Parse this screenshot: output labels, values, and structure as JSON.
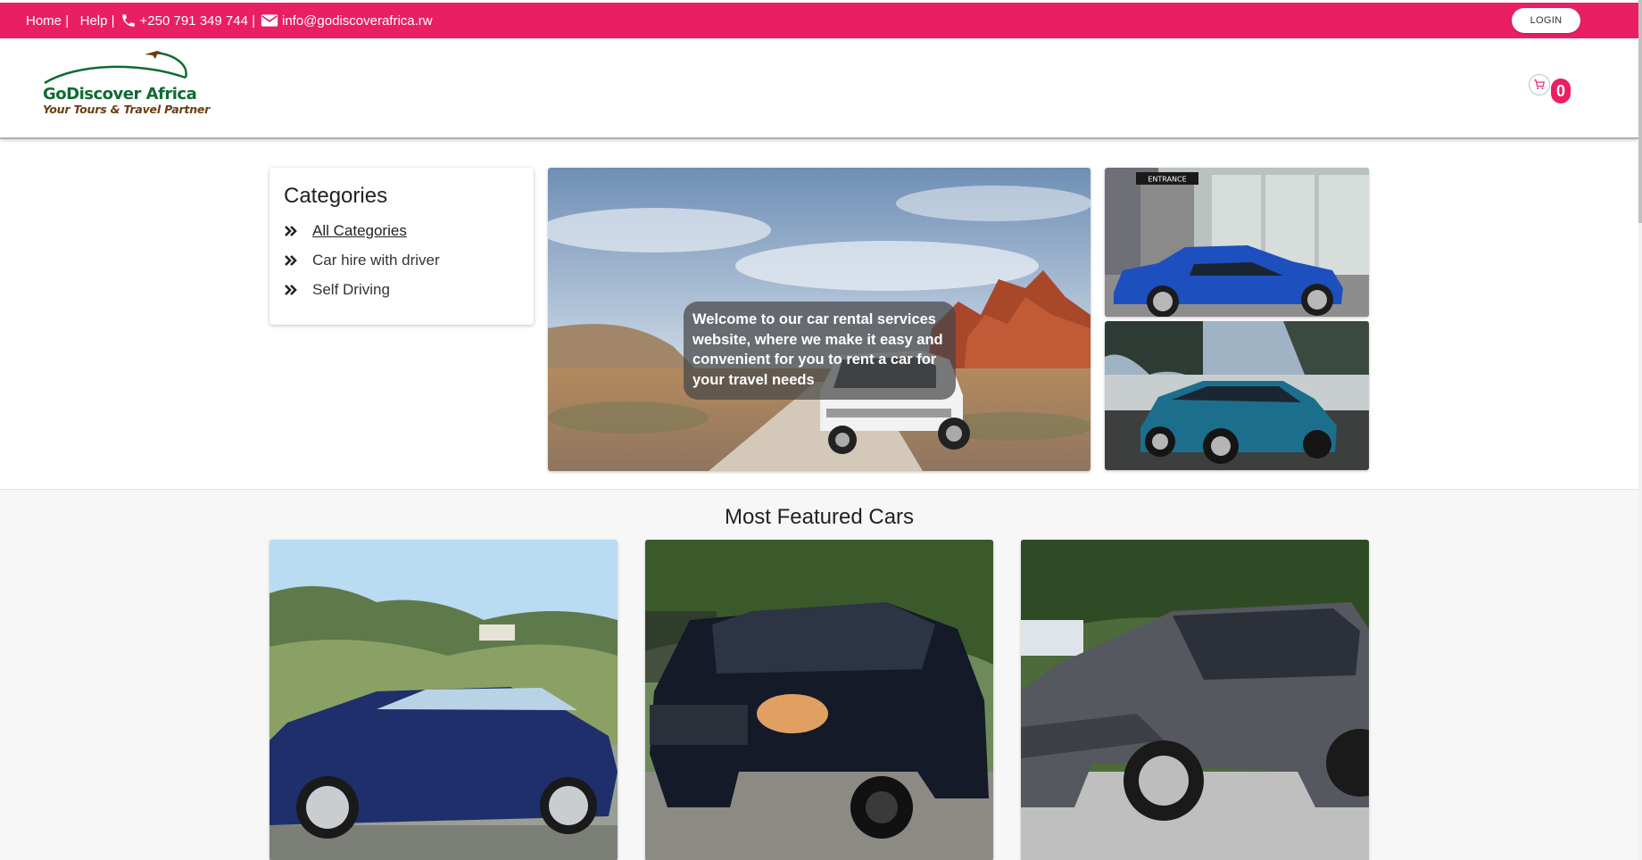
{
  "topbar": {
    "home": "Home",
    "separator": "|",
    "help": "Help",
    "phone": "+250 791 349 744",
    "email": "info@godiscoverafrica.rw",
    "login": "LOGIN",
    "bg_color": "#e91e63"
  },
  "header": {
    "logo_name": "GoDiscover Africa",
    "logo_tagline": "Your Tours & Travel Partner",
    "cart_count": "0"
  },
  "categories": {
    "title": "Categories",
    "items": [
      {
        "label": "All Categories",
        "active": true
      },
      {
        "label": "Car hire with driver",
        "active": false
      },
      {
        "label": "Self Driving",
        "active": false
      }
    ]
  },
  "hero": {
    "caption": "Welcome to our car rental services website, where we make it easy and convenient for you to rent a car for your travel needs",
    "side_sign": "ENTRANCE"
  },
  "featured": {
    "title": "Most Featured Cars"
  },
  "icons": {
    "phone": "phone-icon",
    "email": "email-icon",
    "cart": "cart-icon",
    "chevron": "double-chevron-right-icon"
  }
}
